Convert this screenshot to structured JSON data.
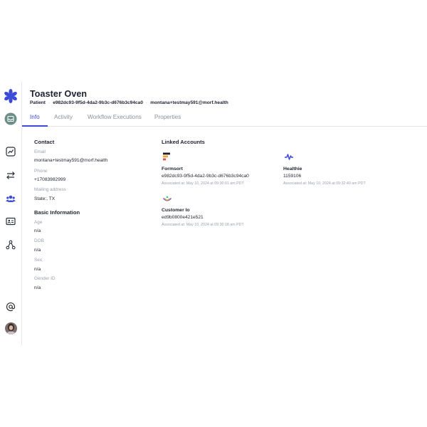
{
  "header": {
    "title": "Toaster Oven",
    "type_label": "Patient",
    "patient_id": "e982dc93-9f5d-4da2-9b3c-d676b3c94ca0",
    "email": "montana+testmay591@morf.health"
  },
  "tabs": [
    {
      "label": "Info",
      "active": true
    },
    {
      "label": "Activity",
      "active": false
    },
    {
      "label": "Workflow Executions",
      "active": false
    },
    {
      "label": "Properties",
      "active": false
    }
  ],
  "contact": {
    "title": "Contact",
    "email_label": "Email",
    "email_value": "montana+testmay591@morf.health",
    "phone_label": "Phone",
    "phone_value": "+17083982999",
    "address_label": "Mailing address",
    "address_value": "State:, TX"
  },
  "basic": {
    "title": "Basic Information",
    "age_label": "Age",
    "age_value": "n/a",
    "dob_label": "DOB",
    "dob_value": "n/a",
    "sex_label": "Sex",
    "sex_value": "n/a",
    "gender_label": "Gender ID",
    "gender_value": "n/a"
  },
  "linked": {
    "title": "Linked Accounts",
    "accounts": [
      {
        "name": "Formsort",
        "id": "e982dc93-9f5d-4da2-9b3c-d676b3c94ca0",
        "time": "Associated at: May 10, 2024 at 09:30:01 am PDT"
      },
      {
        "name": "Healthie",
        "id": "1159106",
        "time": "Associated at: May 10, 2024 at 09:32:40 am PDT"
      },
      {
        "name": "Customer Io",
        "id": "ed9b0800e421e521",
        "time": "Associated at: May 10, 2024 at 09:30:18 am PDT"
      }
    ]
  },
  "sidebar": {
    "icons": [
      "morf-logo-icon",
      "inbox-icon",
      "analytics-icon",
      "transfer-icon",
      "people-icon",
      "id-card-icon",
      "workflow-icon",
      "at-sign-icon",
      "avatar"
    ]
  },
  "colors": {
    "accent": "#3b4bd8",
    "logo": "#3b4bd8",
    "muted": "#9aa0ad"
  }
}
